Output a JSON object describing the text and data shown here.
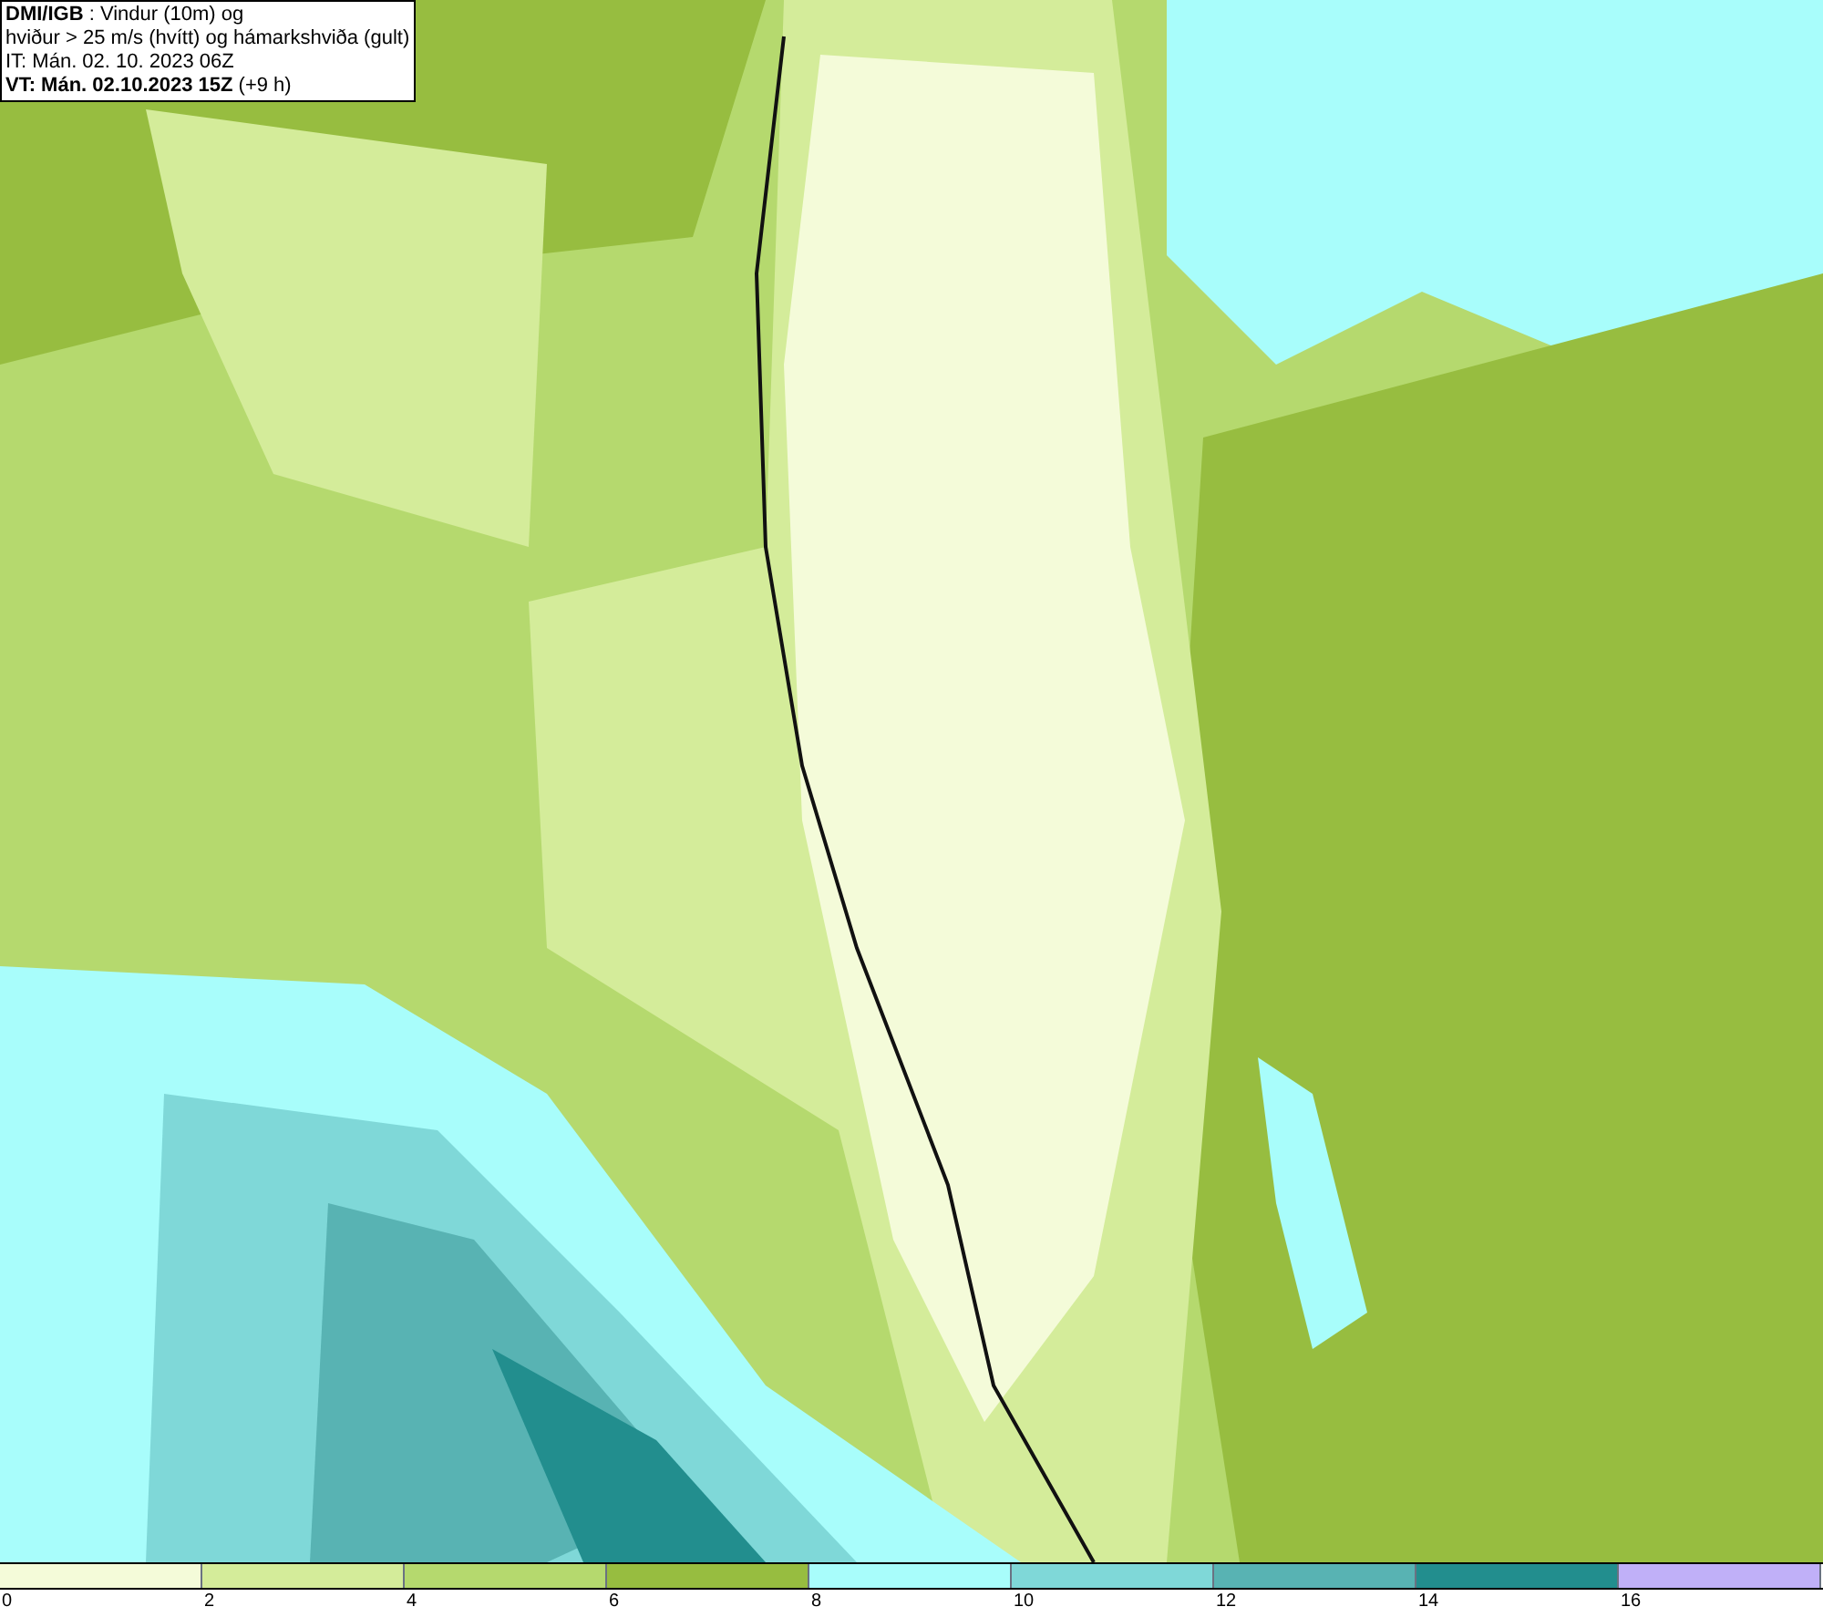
{
  "header": {
    "lines": [
      "**DMI/IGB** : Vindur (10m) og",
      "hviður > 25 m/s (hvítt) og hámarkshviða (gult)",
      "IT: Mán. 02. 10. 2023 06Z",
      "**VT: Mán. 02.10.2023 15Z** (+9 h)"
    ]
  },
  "legend": {
    "bins": [
      {
        "color": "#f4fbd9"
      },
      {
        "color": "#d4ec9a"
      },
      {
        "color": "#b5d96e"
      },
      {
        "color": "#97bd40"
      },
      {
        "color": "#a8fdfb"
      },
      {
        "color": "#7fd8d8"
      },
      {
        "color": "#58b3b3"
      },
      {
        "color": "#228e8e"
      },
      {
        "color": "#c0b0f8"
      }
    ],
    "ticks": [
      "0",
      "2",
      "4",
      "6",
      "8",
      "10",
      "12",
      "14",
      "16"
    ]
  }
}
